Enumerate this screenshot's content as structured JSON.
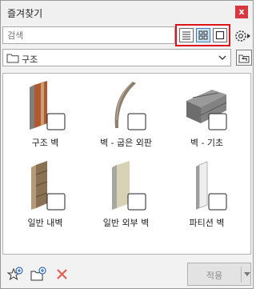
{
  "window": {
    "title": "즐겨찾기",
    "close_glyph": "x"
  },
  "search": {
    "placeholder": "검색",
    "value": ""
  },
  "view_modes": [
    {
      "icon": "list-view-icon",
      "selected": false
    },
    {
      "icon": "grid-view-icon",
      "selected": true
    },
    {
      "icon": "large-view-icon",
      "selected": false
    }
  ],
  "folder": {
    "selected": "구조",
    "icon": "folder-icon"
  },
  "items": [
    {
      "label": "구조 벽",
      "icon": "structural-wall-icon"
    },
    {
      "label": "벽 - 굽은 외판",
      "icon": "curved-wall-icon"
    },
    {
      "label": "벽 - 기초",
      "icon": "foundation-wall-icon"
    },
    {
      "label": "일반 내벽",
      "icon": "interior-wall-icon"
    },
    {
      "label": "일반 외부 벽",
      "icon": "exterior-wall-icon"
    },
    {
      "label": "파티션 벽",
      "icon": "partition-wall-icon"
    }
  ],
  "bottom": {
    "apply_label": "적용",
    "icons": [
      "add-favorite-icon",
      "new-folder-icon",
      "delete-icon"
    ]
  },
  "colors": {
    "highlight": "#e0121b",
    "delete": "#e05a4f",
    "accent_blue": "#2f6db5"
  }
}
